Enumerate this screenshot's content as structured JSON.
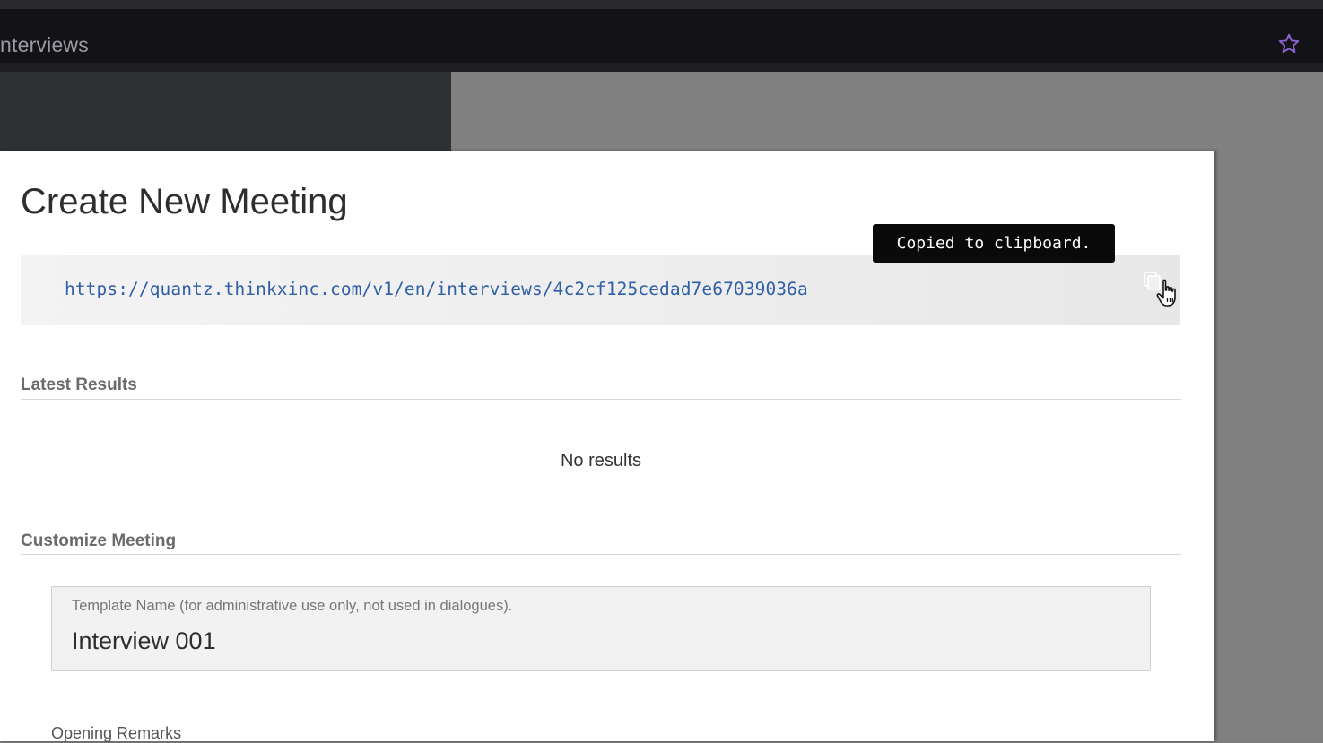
{
  "browser": {
    "tab_title": "nterviews"
  },
  "modal": {
    "title": "Create New Meeting",
    "url": "https://quantz.thinkxinc.com/v1/en/interviews/4c2cf125cedad7e67039036a",
    "tooltip": "Copied to clipboard.",
    "latest_results": {
      "heading": "Latest Results",
      "empty_text": "No results"
    },
    "customize": {
      "heading": "Customize Meeting",
      "template_name_label": "Template Name (for administrative use only, not used in dialogues).",
      "template_name_value": "Interview 001",
      "opening_remarks_label": "Opening Remarks"
    }
  },
  "icons": {
    "bookmark": "star-icon",
    "copy": "copy-icon",
    "cursor": "hand-cursor-icon"
  },
  "colors": {
    "url_text": "#2f5fa6",
    "star": "#8a63d2",
    "tooltip_bg": "#0a0a0a"
  }
}
